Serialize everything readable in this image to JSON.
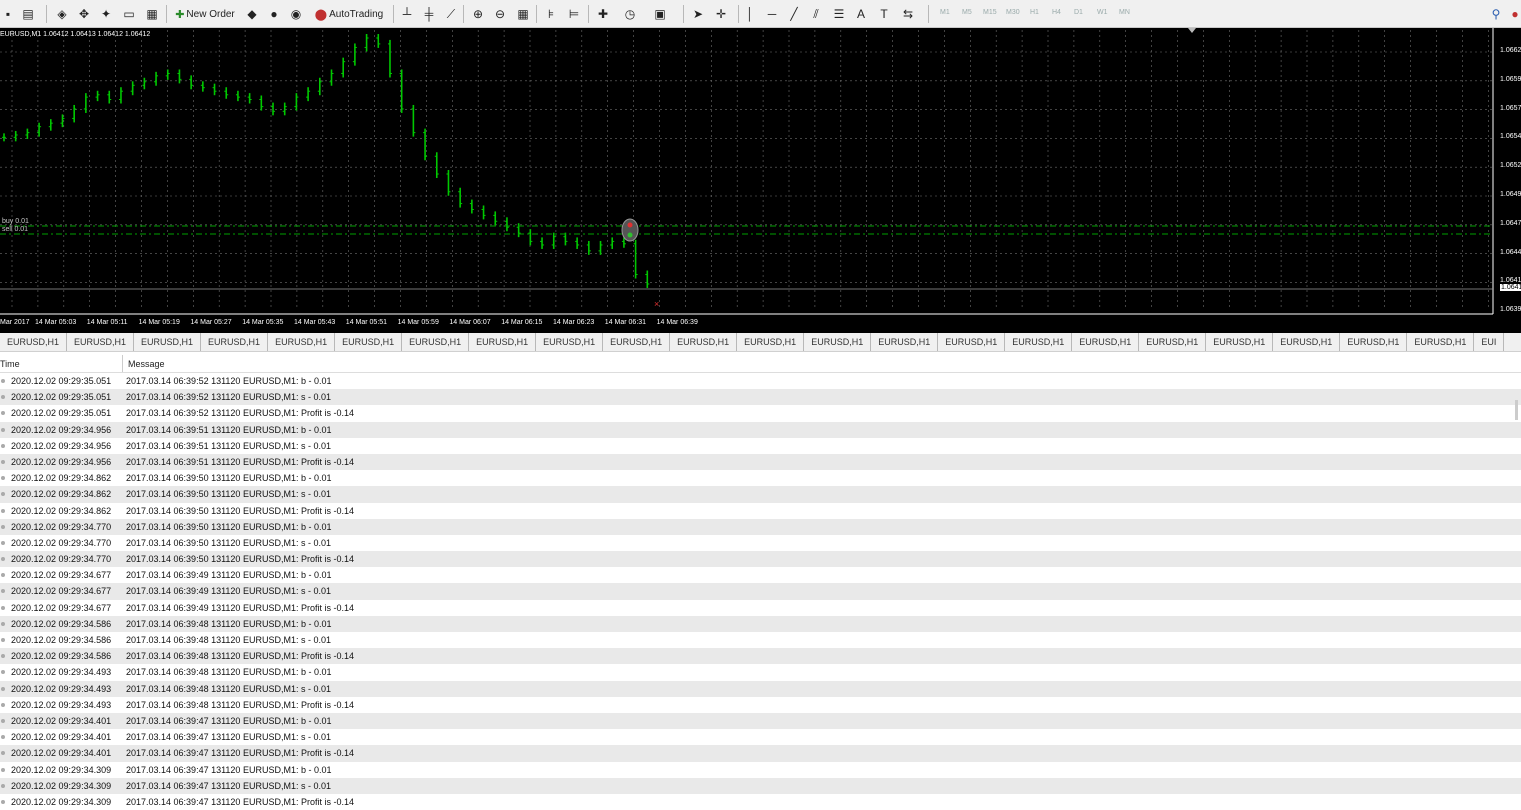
{
  "toolbar": {
    "new_order_label": "New Order",
    "autotrading_label": "AutoTrading",
    "timeframes": [
      "M1",
      "M5",
      "M15",
      "M30",
      "H1",
      "H4",
      "D1",
      "W1",
      "MN"
    ]
  },
  "chart": {
    "info": "EURUSD,M1  1.06412 1.06413 1.06412 1.06412",
    "buy_label": "buy 0.01",
    "sell_label": "sell 0.01",
    "x_ticks": [
      "Mar 2017",
      "14 Mar 05:03",
      "14 Mar 05:11",
      "14 Mar 05:19",
      "14 Mar 05:27",
      "14 Mar 05:35",
      "14 Mar 05:43",
      "14 Mar 05:51",
      "14 Mar 05:59",
      "14 Mar 06:07",
      "14 Mar 06:15",
      "14 Mar 06:23",
      "14 Mar 06:31",
      "14 Mar 06:39"
    ],
    "y_ticks": [
      "1.0662",
      "1.0659",
      "1.0657",
      "1.0654",
      "1.0652",
      "1.0649",
      "1.0647",
      "1.0644",
      "1.0641",
      "1.0639"
    ],
    "current_price": "1.0641",
    "colors": {
      "background": "#000000",
      "candles": "#00c800",
      "trade_line": "#00a000",
      "grid": "#6e6e6e",
      "axis_text": "#ffffff"
    }
  },
  "symbol_tabs": [
    "EURUSD,H1",
    "EURUSD,H1",
    "EURUSD,H1",
    "EURUSD,H1",
    "EURUSD,H1",
    "EURUSD,H1",
    "EURUSD,H1",
    "EURUSD,H1",
    "EURUSD,H1",
    "EURUSD,H1",
    "EURUSD,H1",
    "EURUSD,H1",
    "EURUSD,H1",
    "EURUSD,H1",
    "EURUSD,H1",
    "EURUSD,H1",
    "EURUSD,H1",
    "EURUSD,H1",
    "EURUSD,H1",
    "EURUSD,H1",
    "EURUSD,H1",
    "EURUSD,H1",
    "EUI"
  ],
  "journal": {
    "columns": {
      "time": "Time",
      "message": "Message"
    },
    "rows": [
      {
        "time": "2020.12.02 09:29:35.051",
        "message": "2017.03.14 06:39:52  131120 EURUSD,M1: b - 0.01"
      },
      {
        "time": "2020.12.02 09:29:35.051",
        "message": "2017.03.14 06:39:52  131120 EURUSD,M1: s - 0.01"
      },
      {
        "time": "2020.12.02 09:29:35.051",
        "message": "2017.03.14 06:39:52  131120 EURUSD,M1: Profit is  -0.14"
      },
      {
        "time": "2020.12.02 09:29:34.956",
        "message": "2017.03.14 06:39:51  131120 EURUSD,M1: b - 0.01"
      },
      {
        "time": "2020.12.02 09:29:34.956",
        "message": "2017.03.14 06:39:51  131120 EURUSD,M1: s - 0.01"
      },
      {
        "time": "2020.12.02 09:29:34.956",
        "message": "2017.03.14 06:39:51  131120 EURUSD,M1: Profit is  -0.14"
      },
      {
        "time": "2020.12.02 09:29:34.862",
        "message": "2017.03.14 06:39:50  131120 EURUSD,M1: b - 0.01"
      },
      {
        "time": "2020.12.02 09:29:34.862",
        "message": "2017.03.14 06:39:50  131120 EURUSD,M1: s - 0.01"
      },
      {
        "time": "2020.12.02 09:29:34.862",
        "message": "2017.03.14 06:39:50  131120 EURUSD,M1: Profit is  -0.14"
      },
      {
        "time": "2020.12.02 09:29:34.770",
        "message": "2017.03.14 06:39:50  131120 EURUSD,M1: b - 0.01"
      },
      {
        "time": "2020.12.02 09:29:34.770",
        "message": "2017.03.14 06:39:50  131120 EURUSD,M1: s - 0.01"
      },
      {
        "time": "2020.12.02 09:29:34.770",
        "message": "2017.03.14 06:39:50  131120 EURUSD,M1: Profit is  -0.14"
      },
      {
        "time": "2020.12.02 09:29:34.677",
        "message": "2017.03.14 06:39:49  131120 EURUSD,M1: b - 0.01"
      },
      {
        "time": "2020.12.02 09:29:34.677",
        "message": "2017.03.14 06:39:49  131120 EURUSD,M1: s - 0.01"
      },
      {
        "time": "2020.12.02 09:29:34.677",
        "message": "2017.03.14 06:39:49  131120 EURUSD,M1: Profit is  -0.14"
      },
      {
        "time": "2020.12.02 09:29:34.586",
        "message": "2017.03.14 06:39:48  131120 EURUSD,M1: b - 0.01"
      },
      {
        "time": "2020.12.02 09:29:34.586",
        "message": "2017.03.14 06:39:48  131120 EURUSD,M1: s - 0.01"
      },
      {
        "time": "2020.12.02 09:29:34.586",
        "message": "2017.03.14 06:39:48  131120 EURUSD,M1: Profit is  -0.14"
      },
      {
        "time": "2020.12.02 09:29:34.493",
        "message": "2017.03.14 06:39:48  131120 EURUSD,M1: b - 0.01"
      },
      {
        "time": "2020.12.02 09:29:34.493",
        "message": "2017.03.14 06:39:48  131120 EURUSD,M1: s - 0.01"
      },
      {
        "time": "2020.12.02 09:29:34.493",
        "message": "2017.03.14 06:39:48  131120 EURUSD,M1: Profit is  -0.14"
      },
      {
        "time": "2020.12.02 09:29:34.401",
        "message": "2017.03.14 06:39:47  131120 EURUSD,M1: b - 0.01"
      },
      {
        "time": "2020.12.02 09:29:34.401",
        "message": "2017.03.14 06:39:47  131120 EURUSD,M1: s - 0.01"
      },
      {
        "time": "2020.12.02 09:29:34.401",
        "message": "2017.03.14 06:39:47  131120 EURUSD,M1: Profit is  -0.14"
      },
      {
        "time": "2020.12.02 09:29:34.309",
        "message": "2017.03.14 06:39:47  131120 EURUSD,M1: b - 0.01"
      },
      {
        "time": "2020.12.02 09:29:34.309",
        "message": "2017.03.14 06:39:47  131120 EURUSD,M1: s - 0.01"
      },
      {
        "time": "2020.12.02 09:29:34.309",
        "message": "2017.03.14 06:39:47  131120 EURUSD,M1: Profit is  -0.14"
      }
    ]
  },
  "chart_data": {
    "type": "line",
    "title": "",
    "xlabel": "",
    "ylabel": "",
    "series": [
      {
        "values": [
          1.06536,
          1.06538,
          1.0654,
          1.06545,
          1.06548,
          1.06552,
          1.0656,
          1.0657,
          1.06572,
          1.06568,
          1.06575,
          1.0658,
          1.06583,
          1.06588,
          1.0659,
          1.06585,
          1.0658,
          1.06578,
          1.06575,
          1.06572,
          1.0657,
          1.06568,
          1.06562,
          1.06558,
          1.06562,
          1.0657,
          1.06575,
          1.06583,
          1.0659,
          1.066,
          1.06612,
          1.0662,
          1.06615,
          1.0659,
          1.0656,
          1.0654,
          1.0652,
          1.06505,
          1.0649,
          1.0648,
          1.06475,
          1.0647,
          1.06465,
          1.0646,
          1.06455,
          1.06448,
          1.06445,
          1.06452,
          1.06448,
          1.06445,
          1.0644,
          1.06445,
          1.06448,
          1.06446,
          1.0642,
          1.06412
        ]
      }
    ],
    "ylim": [
      1.0639,
      1.0662
    ],
    "grid": true
  }
}
